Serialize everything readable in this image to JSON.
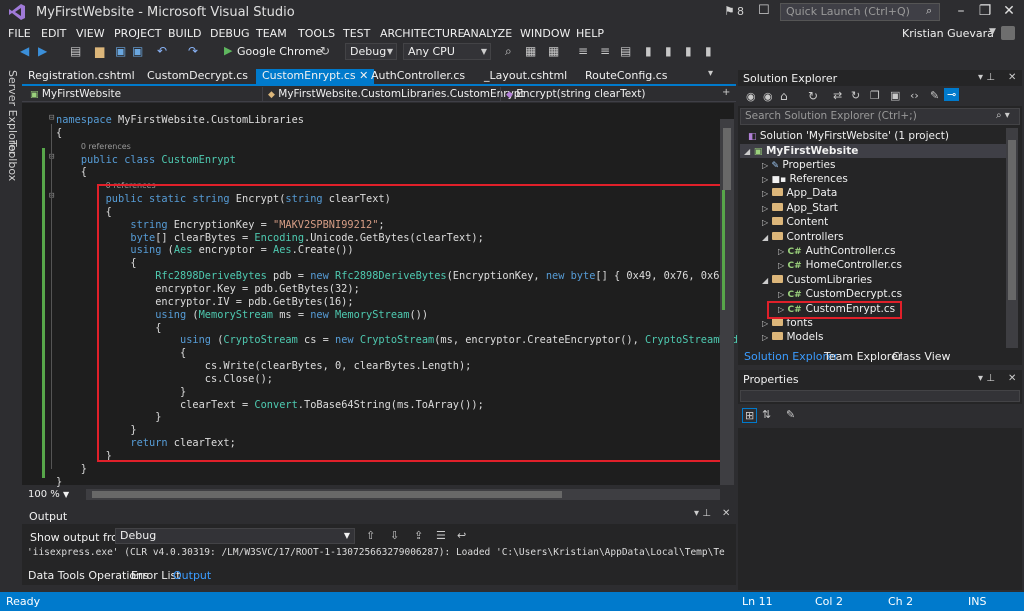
{
  "window": {
    "title": "MyFirstWebsite - Microsoft Visual Studio",
    "notifications": "8",
    "quick_launch_placeholder": "Quick Launch (Ctrl+Q)",
    "user": "Kristian Guevara"
  },
  "menu": [
    "FILE",
    "EDIT",
    "VIEW",
    "PROJECT",
    "BUILD",
    "DEBUG",
    "TEAM",
    "TOOLS",
    "TEST",
    "ARCHITECTURE",
    "ANALYZE",
    "WINDOW",
    "HELP"
  ],
  "toolbar": {
    "run_target": "Google Chrome",
    "configuration": "Debug",
    "platform": "Any CPU"
  },
  "side_tabs": [
    "Server Explorer",
    "Toolbox"
  ],
  "doc_tabs": [
    "Registration.cshtml",
    "CustomDecrypt.cs",
    "CustomEnrypt.cs",
    "AuthController.cs",
    "_Layout.cshtml",
    "RouteConfig.cs"
  ],
  "nav": {
    "project": "MyFirstWebsite",
    "class": "MyFirstWebsite.CustomLibraries.CustomEnrypt",
    "member": "Encrypt(string clearText)"
  },
  "code": {
    "refs": "0 references",
    "zoom": "100 %"
  },
  "output": {
    "title": "Output",
    "show_from_label": "Show output from:",
    "source": "Debug",
    "text": "'iisexpress.exe' (CLR v4.0.30319: /LM/W3SVC/17/ROOT-1-130725663279006287): Loaded 'C:\\Users\\Kristian\\AppData\\Local\\Temp\\Te",
    "tabs": [
      "Data Tools Operations",
      "Error List",
      "Output"
    ]
  },
  "solution_explorer": {
    "title": "Solution Explorer",
    "search_placeholder": "Search Solution Explorer (Ctrl+;)",
    "solution": "Solution 'MyFirstWebsite' (1 project)",
    "project": "MyFirstWebsite",
    "items": [
      "Properties",
      "References",
      "App_Data",
      "App_Start",
      "Content",
      "Controllers",
      "AuthController.cs",
      "HomeController.cs",
      "CustomLibraries",
      "CustomDecrypt.cs",
      "CustomEnrypt.cs",
      "fonts",
      "Models"
    ],
    "tabs": [
      "Solution Explorer",
      "Team Explorer",
      "Class View"
    ]
  },
  "properties": {
    "title": "Properties"
  },
  "status": {
    "state": "Ready",
    "line": "Ln 11",
    "col": "Col 2",
    "ch": "Ch 2",
    "mode": "INS"
  },
  "colors": {
    "accent": "#007acc",
    "highlight": "#e0202a",
    "keyword": "#569cd6",
    "type": "#4ec9b0",
    "string": "#d69d85"
  }
}
